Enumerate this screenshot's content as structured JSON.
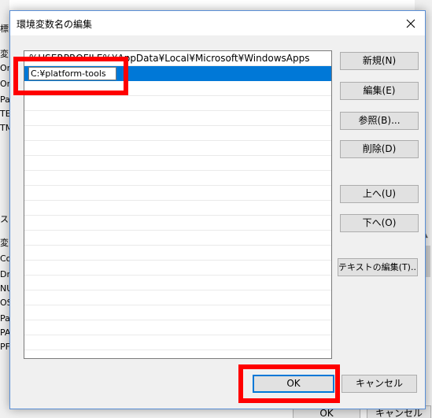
{
  "dialog": {
    "title": "環境変数名の編集",
    "entries": [
      "%USERPROFILE%\\AppData\\Local\\Microsoft\\WindowsApps"
    ],
    "editing_value": "C:¥platform-tools",
    "first_entry_display": "%USERPROFILE%¥AppData¥Local¥Microsoft¥WindowsApps",
    "buttons": {
      "new": "新規(N)",
      "edit": "編集(E)",
      "browse": "参照(B)...",
      "delete": "削除(D)",
      "up": "上へ(U)",
      "down": "下へ(O)",
      "edit_text": "テキストの編集(T)...",
      "ok": "OK",
      "cancel": "キャンセル"
    }
  },
  "background": {
    "left_fragments": [
      "標",
      "変",
      "On",
      "On",
      "Pa",
      "TE",
      "TM",
      "ス",
      "変",
      "Co",
      "Dr",
      "NU",
      "OS",
      "Pa",
      "PA",
      "PF"
    ],
    "bottom_buttons": [
      "OK",
      "キャンセル"
    ]
  },
  "colors": {
    "selection": "#0078d7",
    "highlight": "#ff0000",
    "button_face": "#e1e1e1"
  }
}
